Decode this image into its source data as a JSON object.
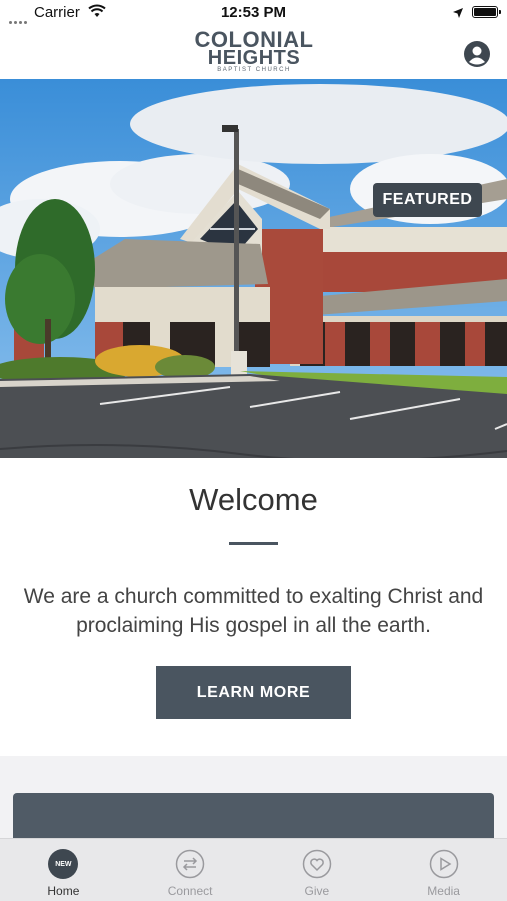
{
  "status_bar": {
    "carrier": "Carrier",
    "time": "12:53 PM"
  },
  "header": {
    "logo_line1": "COLONIAL",
    "logo_line2": "HEIGHTS",
    "logo_line3": "BAPTIST CHURCH",
    "accent_color": "#e2862c",
    "icons": [
      "profile-icon"
    ]
  },
  "hero": {
    "badge": "FEATURED"
  },
  "welcome": {
    "title": "Welcome",
    "text": "We are a church committed to exalting Christ and proclaiming His gospel in all the earth.",
    "button": "LEARN MORE"
  },
  "tabs": [
    {
      "label": "Home",
      "icon": "new-icon",
      "badge": "NEW",
      "active": true
    },
    {
      "label": "Connect",
      "icon": "connect-arrows-icon",
      "active": false
    },
    {
      "label": "Give",
      "icon": "heart-icon",
      "active": false
    },
    {
      "label": "Media",
      "icon": "play-icon",
      "active": false
    }
  ],
  "colors": {
    "primary": "#4a5560",
    "badge_bg": "#3e4750"
  }
}
